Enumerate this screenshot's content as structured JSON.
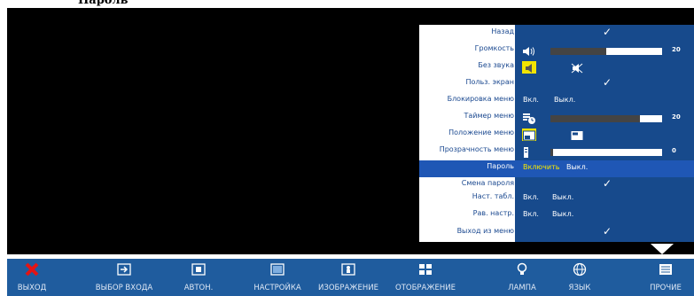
{
  "header": {
    "title": "Пароль"
  },
  "menu": {
    "items": [
      {
        "label": "Назад"
      },
      {
        "label": "Громкость",
        "value": 20,
        "max": 40
      },
      {
        "label": "Без звука"
      },
      {
        "label": "Польз. экран"
      },
      {
        "label": "Блокировка меню",
        "options": [
          "Вкл.",
          "Выкл."
        ]
      },
      {
        "label": "Таймер меню",
        "value": 20,
        "max": 25
      },
      {
        "label": "Положение меню"
      },
      {
        "label": "Прозрачность меню",
        "value": 0,
        "max": 100
      },
      {
        "label": "Пароль",
        "options": [
          "Включить",
          "Выкл."
        ],
        "selected": "Включить"
      },
      {
        "label": "Смена пароля"
      },
      {
        "label": "Наст. табл.",
        "options": [
          "Вкл.",
          "Выкл."
        ]
      },
      {
        "label": "Рав. настр.",
        "options": [
          "Вкл.",
          "Выкл."
        ]
      },
      {
        "label": "Выход из меню"
      }
    ]
  },
  "bottom_nav": [
    {
      "label": "ВЫХОД",
      "icon": "exit-icon"
    },
    {
      "label": "ВЫБОР ВХОДА",
      "icon": "input-select-icon"
    },
    {
      "label": "АВТОН.",
      "icon": "auto-adjust-icon"
    },
    {
      "label": "НАСТРОЙКА",
      "icon": "setup-icon"
    },
    {
      "label": "ИЗОБРАЖЕНИЕ",
      "icon": "picture-icon"
    },
    {
      "label": "ОТОБРАЖЕНИЕ",
      "icon": "display-icon"
    },
    {
      "label": "ЛАМПА",
      "icon": "lamp-icon"
    },
    {
      "label": "ЯЗЫК",
      "icon": "language-globe-icon"
    },
    {
      "label": "ПРОЧИЕ",
      "icon": "others-icon"
    }
  ],
  "colors": {
    "accent": "#1f5c9e",
    "highlight": "#1f57b5",
    "label_text": "#1b4990",
    "on_value": "#f7e800",
    "exit": "#e31414"
  }
}
